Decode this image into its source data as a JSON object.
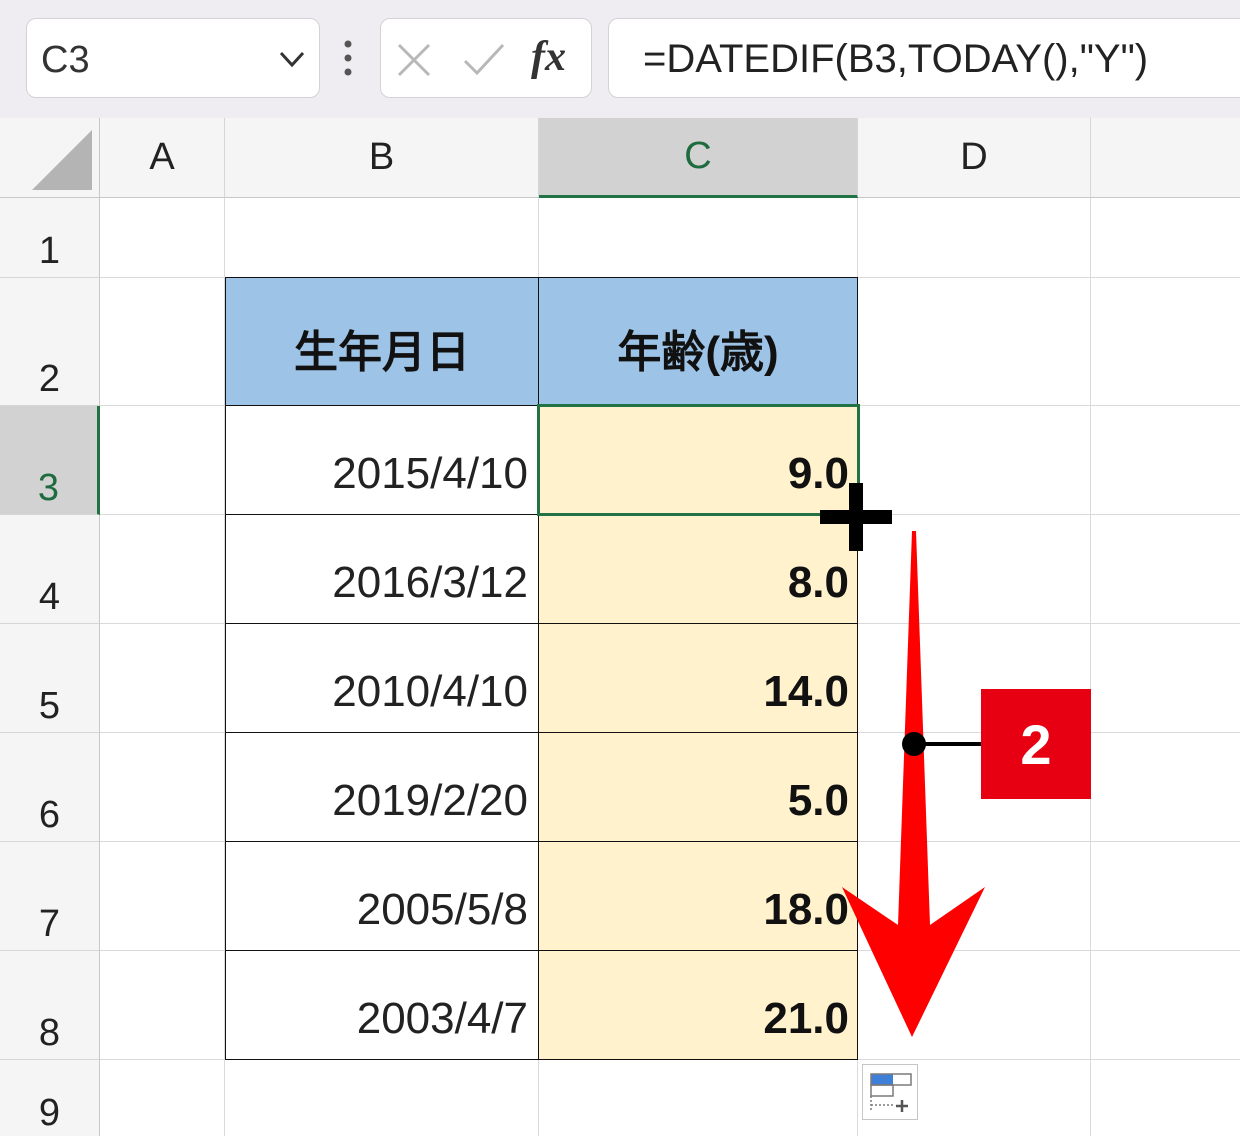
{
  "formula_bar": {
    "name_box": "C3",
    "name_box_arrow_icon": "chevron-down-icon",
    "cancel_icon": "cancel-x-icon",
    "enter_icon": "checkmark-icon",
    "fx_label": "fx",
    "formula": "=DATEDIF(B3,TODAY(),\"Y\")"
  },
  "columns": [
    "A",
    "B",
    "C",
    "D"
  ],
  "rows": [
    "1",
    "2",
    "3",
    "4",
    "5",
    "6",
    "7",
    "8",
    "9"
  ],
  "active_cell": {
    "column": "C",
    "row": "3"
  },
  "table": {
    "headers": [
      "生年月日",
      "年齢(歳)"
    ],
    "rows": [
      {
        "birthdate": "2015/4/10",
        "age": "9.0"
      },
      {
        "birthdate": "2016/3/12",
        "age": "8.0"
      },
      {
        "birthdate": "2010/4/10",
        "age": "14.0"
      },
      {
        "birthdate": "2019/2/20",
        "age": "5.0"
      },
      {
        "birthdate": "2005/5/8",
        "age": "18.0"
      },
      {
        "birthdate": "2003/4/7",
        "age": "21.0"
      }
    ]
  },
  "annotation": {
    "step_badge": "2",
    "arrow_direction": "down"
  },
  "colors": {
    "header_fill": "#9dc3e6",
    "age_fill": "#fff2cc",
    "selection": "#217346",
    "annotation_red": "#e60012"
  }
}
